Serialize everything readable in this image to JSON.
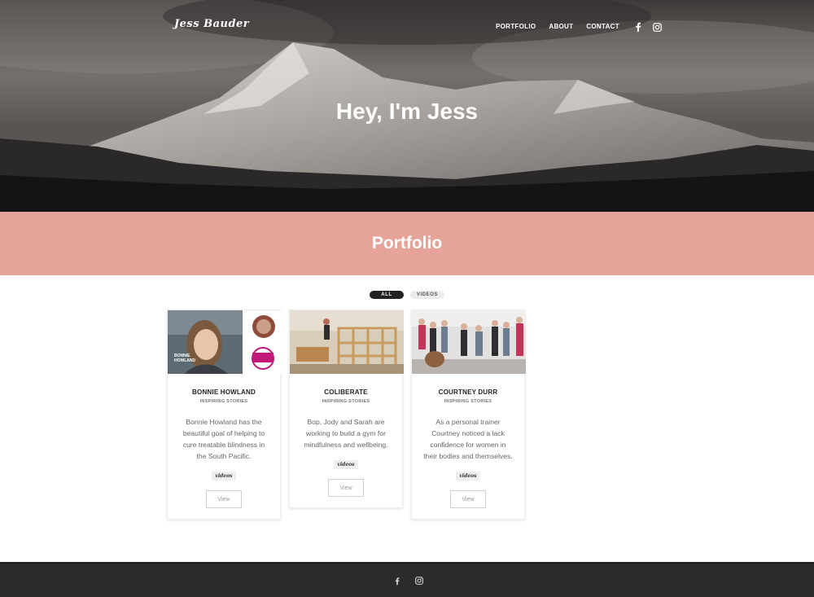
{
  "site": {
    "logo": "Jess Bauder"
  },
  "nav": {
    "items": [
      {
        "label": "PORTFOLIO",
        "active": true
      },
      {
        "label": "ABOUT",
        "active": false
      },
      {
        "label": "CONTACT",
        "active": false
      }
    ],
    "social_icons": [
      "facebook-icon",
      "instagram-icon"
    ]
  },
  "hero": {
    "title": "Hey, I'm Jess"
  },
  "section": {
    "title": "Portfolio"
  },
  "filters": {
    "all_label": "ALL",
    "videos_label": "VIDEOS"
  },
  "cards": [
    {
      "name": "BONNIE HOWLAND",
      "category": "INSPIRING STORIES",
      "description": "Bonnie Howland has the beautiful goal of helping to cure treatable blindness in the South Pacific.",
      "tag": "videos",
      "button": "View",
      "thumb_caption": "BONNIE HOWLAND"
    },
    {
      "name": "COLIBERATE",
      "category": "INSPIRING STORIES",
      "description": "Bop, Jody and Sarah are working to build a gym for mindfulness and wellbeing.",
      "tag": "videos",
      "button": "View"
    },
    {
      "name": "COURTNEY DURR",
      "category": "INSPIRING STORIES",
      "description": "As a personal trainer Courtney noticed a lack confidence for women in their bodies and themselves.",
      "tag": "videos",
      "button": "View"
    }
  ],
  "footer": {
    "social_icons": [
      "facebook-icon",
      "instagram-icon"
    ]
  },
  "colors": {
    "accent_band": "#e6a399",
    "footer_bg": "#2b2b2c",
    "filter_active_bg": "#222222"
  }
}
